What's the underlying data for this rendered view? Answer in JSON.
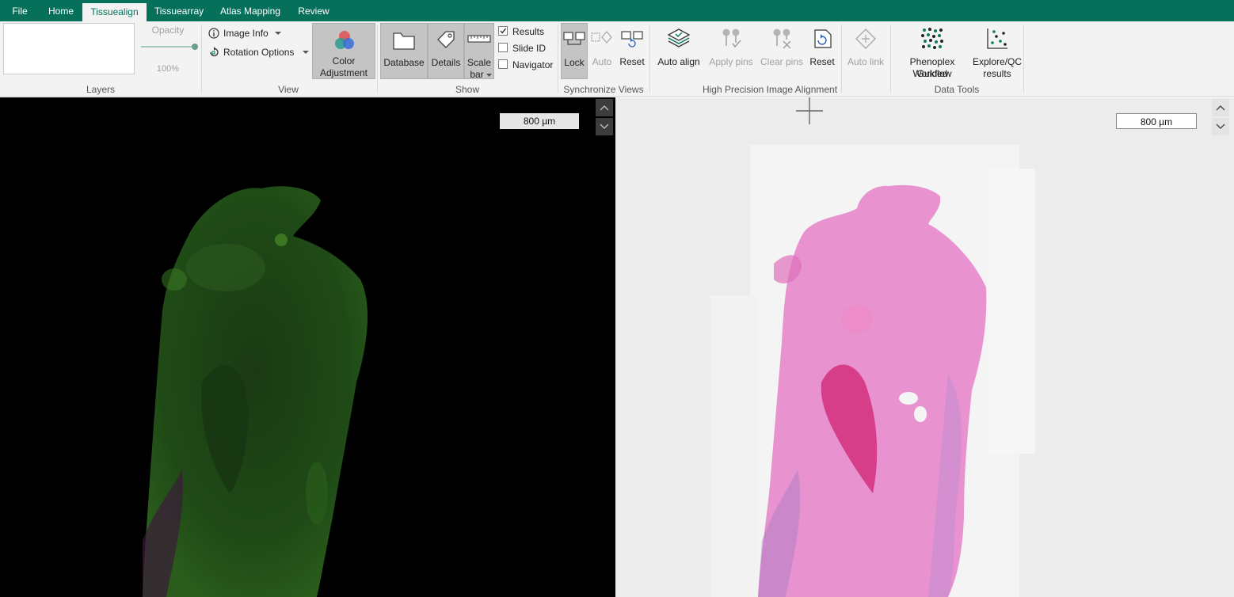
{
  "menu": {
    "tabs": [
      "File",
      "Home",
      "Tissuealign",
      "Tissuearray",
      "Atlas Mapping",
      "Review"
    ],
    "active_tab": "Tissuealign"
  },
  "ribbon": {
    "layers": {
      "opacity_label": "Opacity",
      "opacity_value": "100%",
      "group_label": "Layers"
    },
    "view": {
      "image_info": "Image Info",
      "rotation_options": "Rotation Options",
      "color_adjustment_line1": "Color",
      "color_adjustment_line2": "Adjustment",
      "group_label": "View"
    },
    "show": {
      "database": "Database",
      "details": "Details",
      "scale_bar_line1": "Scale",
      "scale_bar_line2": "bar",
      "results": "Results",
      "results_checked": true,
      "slide_id": "Slide ID",
      "slide_id_checked": false,
      "navigator": "Navigator",
      "navigator_checked": false,
      "group_label": "Show"
    },
    "sync": {
      "lock": "Lock",
      "auto": "Auto",
      "reset": "Reset",
      "group_label": "Synchronize Views"
    },
    "alignment": {
      "auto_align": "Auto align",
      "apply_pins": "Apply pins",
      "clear_pins": "Clear pins",
      "reset": "Reset",
      "auto_link": "Auto link",
      "group_label": "High Precision Image Alignment"
    },
    "data_tools": {
      "phenoplex_line1": "Phenoplex Guided",
      "phenoplex_line2": "Workflow",
      "explore_line1": "Explore/QC",
      "explore_line2": "results",
      "group_label": "Data Tools"
    }
  },
  "viewers": {
    "left_scale": "800 µm",
    "right_scale": "800 µm"
  },
  "colors": {
    "brand": "#06705a",
    "ribbon_bg": "#f3f3f3",
    "left_bg": "#000000",
    "right_bg": "#ececec",
    "he_pink": "#e892d0",
    "fluor_green": "#1f4a16"
  }
}
